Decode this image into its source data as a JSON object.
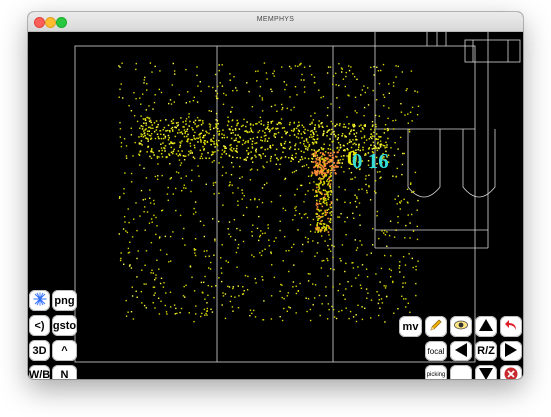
{
  "window": {
    "title": "MEMPHYS"
  },
  "overlay": {
    "text": "0 16",
    "color": "#33ddd8",
    "stack_color": "#e8e800"
  },
  "colors": {
    "hits": "#dada00",
    "hits_bright": "#ffff44",
    "core": "#ff8a3a",
    "wire": "#d8d8d8"
  },
  "left_panel": {
    "rows": [
      {
        "left": {
          "icon": "blue-star-icon"
        },
        "right": {
          "label": "png"
        }
      },
      {
        "left": {
          "label": "<)"
        },
        "right": {
          "label": "gsto"
        }
      },
      {
        "left": {
          "label": "3D"
        },
        "right": {
          "label": "^"
        }
      },
      {
        "left": {
          "label": "W/B"
        },
        "right": {
          "label": "N"
        }
      }
    ]
  },
  "right_panel": {
    "mv_label": "mv",
    "focal_label": "focal",
    "picking_label": "picking",
    "rz_label": "R/Z",
    "icons": {
      "pencil": "pencil-icon",
      "eye": "eye-icon",
      "undo": "undo-arrow-icon",
      "up": "arrow-up-icon",
      "left": "arrow-left-icon",
      "right": "arrow-right-icon",
      "down": "arrow-down-icon",
      "close": "close-icon"
    }
  }
}
